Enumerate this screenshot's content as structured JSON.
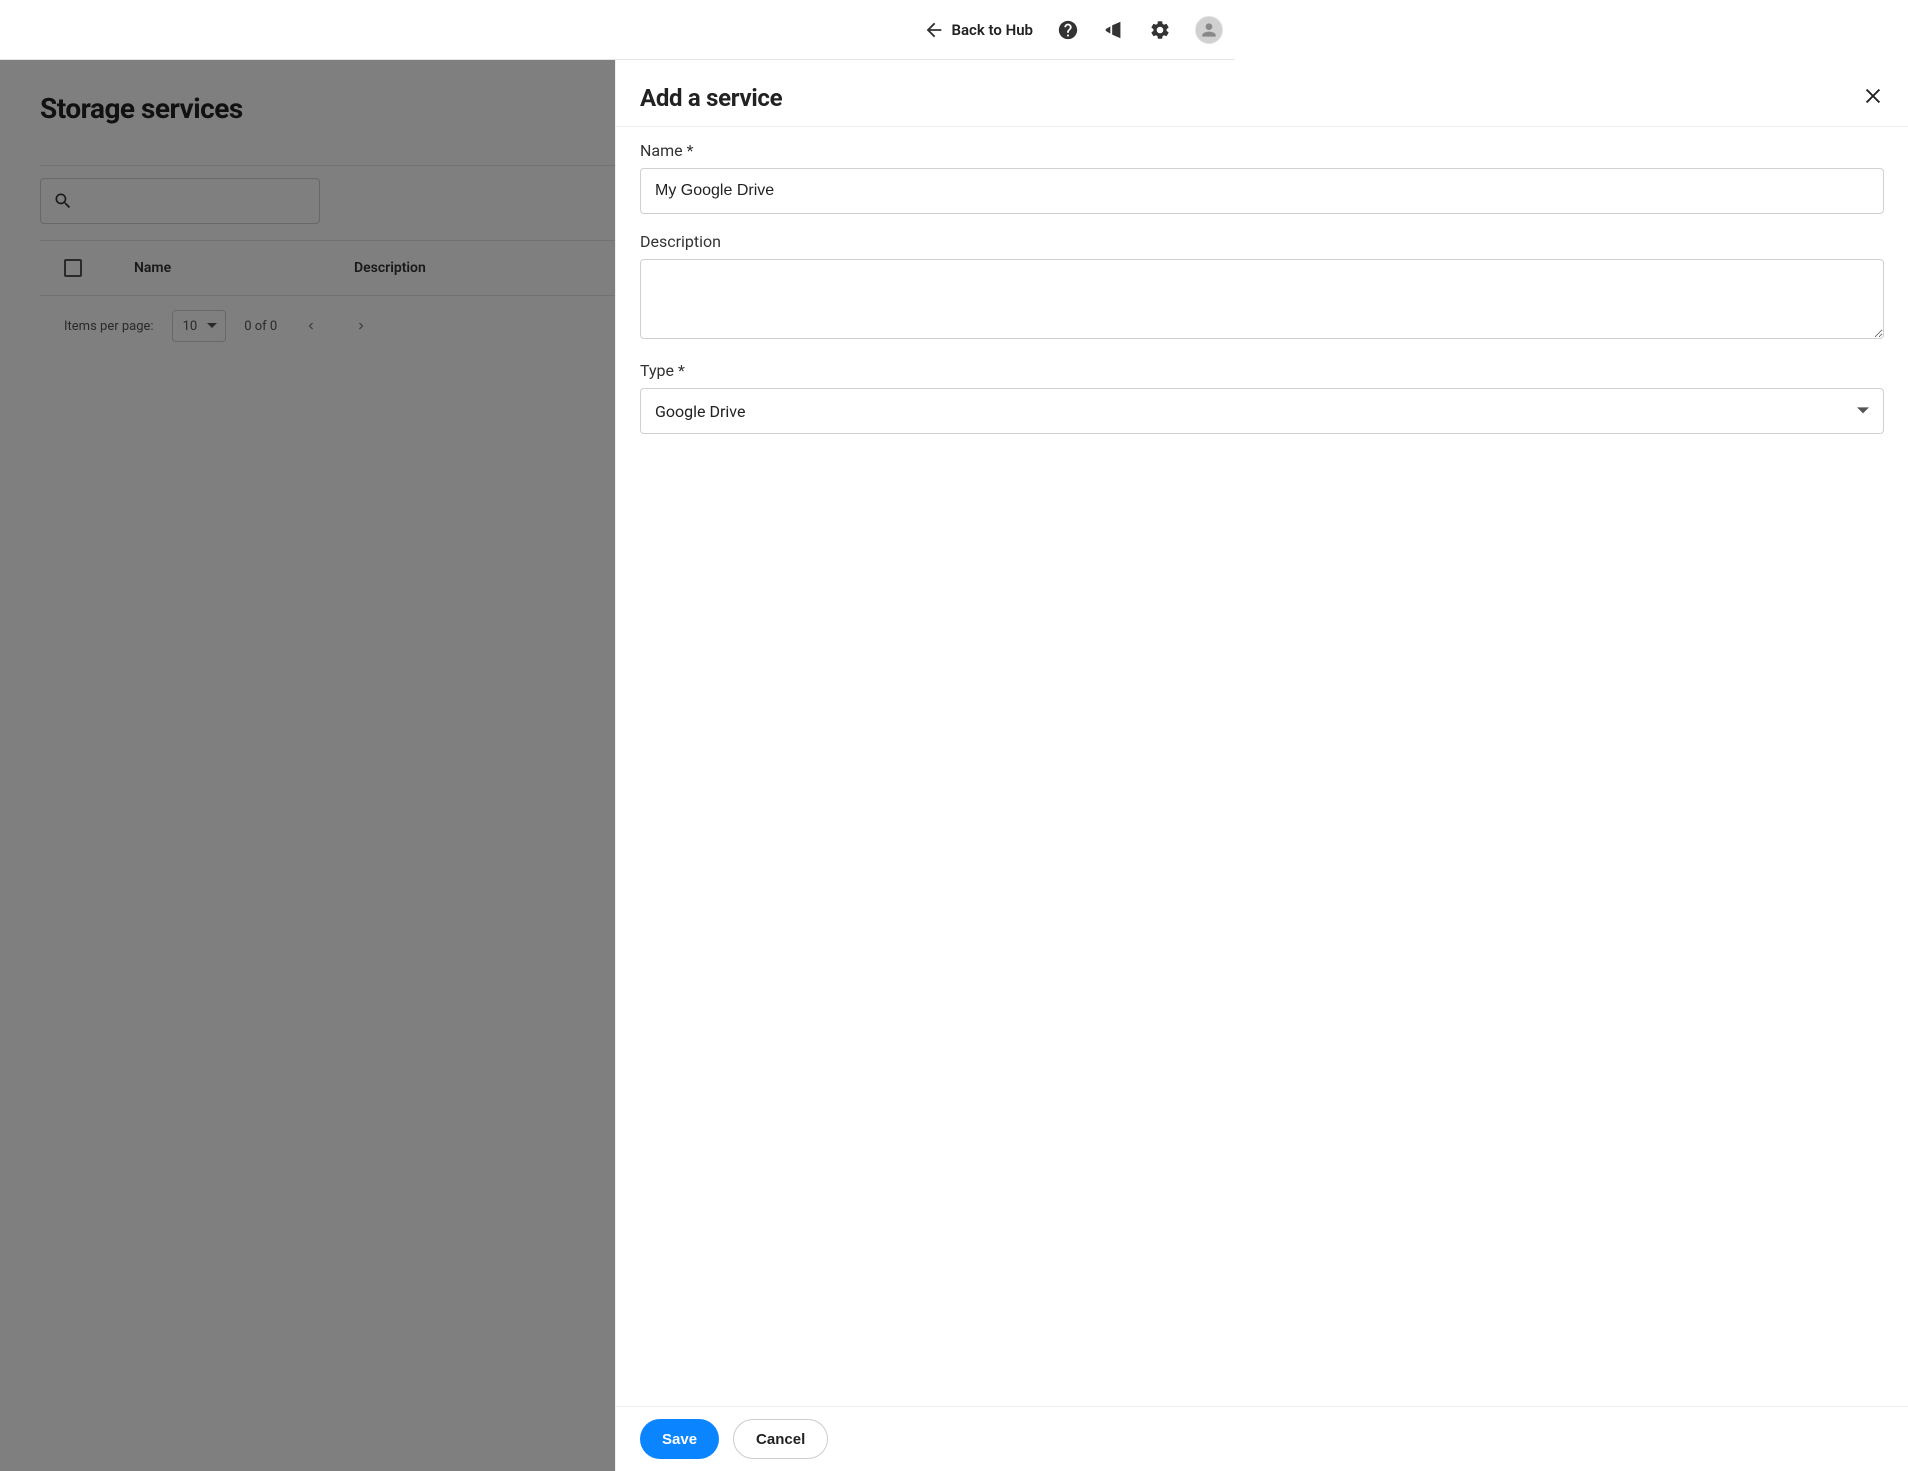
{
  "header": {
    "back_label": "Back to Hub"
  },
  "page": {
    "title": "Storage services",
    "columns": {
      "name": "Name",
      "description": "Description"
    },
    "paginator": {
      "items_per_page_label": "Items per page:",
      "items_per_page_value": "10",
      "range_label": "0 of 0"
    }
  },
  "panel": {
    "title": "Add a service",
    "fields": {
      "name": {
        "label": "Name *",
        "value": "My Google Drive"
      },
      "description": {
        "label": "Description",
        "value": ""
      },
      "type": {
        "label": "Type *",
        "value": "Google Drive"
      }
    },
    "buttons": {
      "save": "Save",
      "cancel": "Cancel"
    }
  }
}
